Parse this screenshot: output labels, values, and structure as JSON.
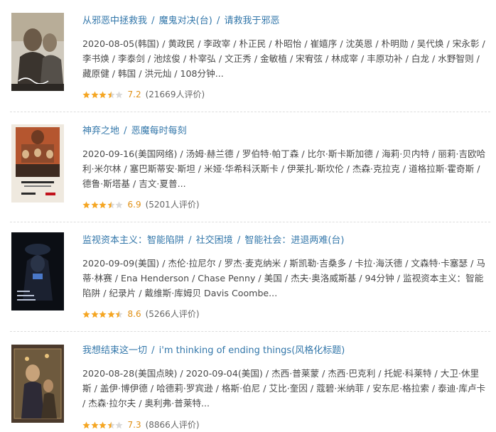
{
  "colors": {
    "link": "#3377aa",
    "meta_text": "#494949",
    "score": "#e09015",
    "star_fill": "#f5a623",
    "star_empty": "#d9d9d9"
  },
  "items": [
    {
      "poster_icon": "movie-poster-deliver-us-from-evil",
      "titles": [
        "从邪恶中拯救我",
        "魔鬼对决(台)",
        "请救我于邪恶"
      ],
      "meta": "2020-08-05(韩国) / 黄政民 / 李政宰 / 朴正民 / 朴昭怡 / 崔嬉序 / 沈英恩 / 朴明勋 / 吴代焕 / 宋永彰 / 李书焕 / 李泰剑 / 池炫俊 / 朴宰弘 / 文正秀 / 金敏植 / 宋宥弦 / 林成宰 / 丰原功补 / 白龙 / 水野智则 / 藏原健 / 韩国 / 洪元灿 / 108分钟...",
      "stars": 3.5,
      "score": "7.2",
      "votes": "(21669人评价)"
    },
    {
      "poster_icon": "movie-poster-the-devil-all-the-time",
      "titles": [
        "神弃之地",
        "恶魔每时每刻"
      ],
      "meta": "2020-09-16(美国网络) / 汤姆·赫兰德 / 罗伯特·帕丁森 / 比尔·斯卡斯加德 / 海莉·贝内特 / 丽莉·吉欧哈利·米尔林 / 塞巴斯蒂安·斯坦 / 米娅·华希科沃斯卡 / 伊莱扎·斯坎伦 / 杰森·克拉克 / 道格拉斯·霍奇斯 / 德鲁·斯塔基 / 吉文·夏普...",
      "stars": 3.5,
      "score": "6.9",
      "votes": "(5201人评价)"
    },
    {
      "poster_icon": "movie-poster-the-social-dilemma",
      "titles": [
        "监视资本主义：智能陷阱",
        "社交困境",
        "智能社会：进退两难(台)"
      ],
      "meta": "2020-09-09(美国) / 杰伦·拉尼尔 / 罗杰·麦克纳米 / 斯凯勒·吉桑多 / 卡拉·海沃德 / 文森特·卡塞瑟 / 马蒂·林赛 / Ena Henderson / Chase Penny / 美国 / 杰夫·奥洛威斯基 / 94分钟 / 监视资本主义：智能陷阱 / 纪录片 / 戴维斯·库姆贝 Davis Coombe...",
      "stars": 4.5,
      "score": "8.6",
      "votes": "(5266人评价)"
    },
    {
      "poster_icon": "movie-poster-im-thinking-of-ending-things",
      "titles": [
        "我想结束这一切",
        "i'm thinking of ending things(风格化标题)"
      ],
      "meta": "2020-08-28(美国点映) / 2020-09-04(美国) / 杰西·普莱蒙 / 杰西·巴克利 / 托妮·科莱特 / 大卫·休里斯 / 盖伊·博伊德 / 哈德莉·罗宾逊 / 格斯·伯尼 / 艾比·奎因 / 蔻碧·米纳菲 / 安东尼·格拉索 / 泰迪·库卢卡 / 杰森·拉尔夫 / 奥利弗·普莱特...",
      "stars": 3.5,
      "score": "7.3",
      "votes": "(8866人评价)"
    }
  ]
}
